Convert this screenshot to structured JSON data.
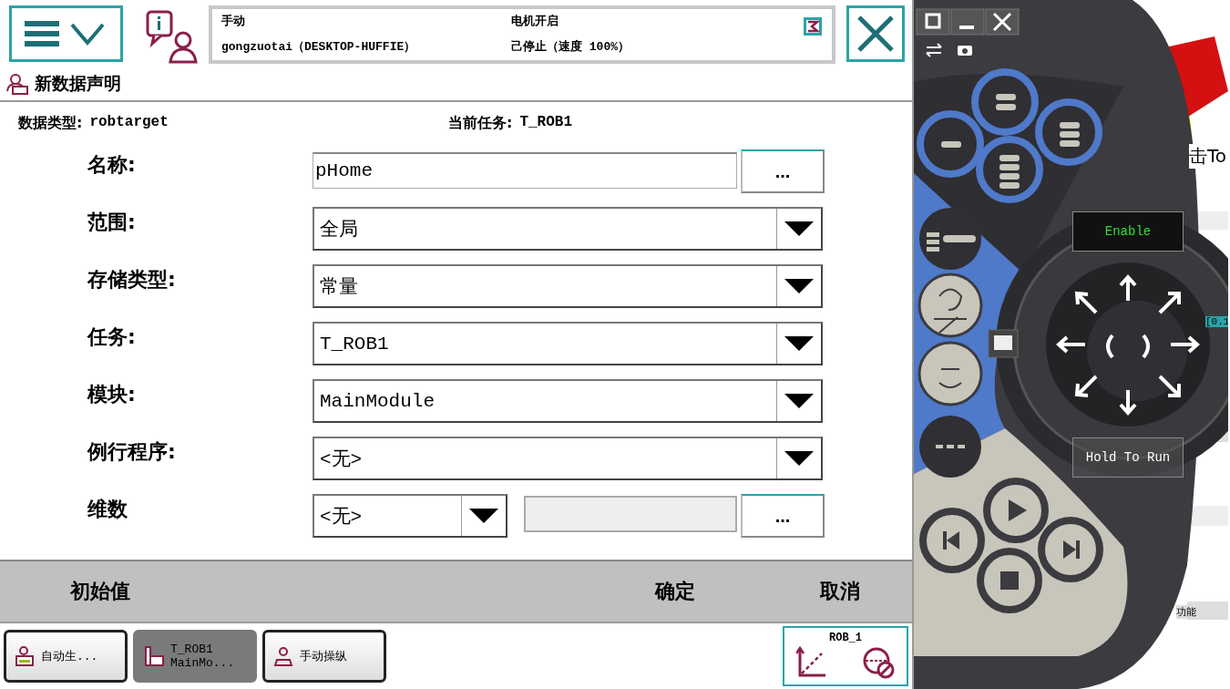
{
  "status": {
    "mode": "手动",
    "system": "gongzuotai（DESKTOP-HUFFIE）",
    "motors": "电机开启",
    "state": "己停止（速度 100%）"
  },
  "title": "新数据声明",
  "info": [
    {
      "label": "数据类型:",
      "value": "robtarget"
    },
    {
      "label": "当前任务:",
      "value": "T_ROB1"
    }
  ],
  "fields": [
    {
      "kind": "text",
      "label": "名称:",
      "value": "pHome",
      "button": "..."
    },
    {
      "kind": "dropdown",
      "label": "范围:",
      "value": "全局"
    },
    {
      "kind": "dropdown",
      "label": "存储类型:",
      "value": "常量"
    },
    {
      "kind": "dropdown",
      "label": "任务:",
      "value": "T_ROB1"
    },
    {
      "kind": "dropdown",
      "label": "模块:",
      "value": "MainModule"
    },
    {
      "kind": "dropdown",
      "label": "例行程序:",
      "value": "<无>"
    },
    {
      "kind": "dims",
      "label": "维数",
      "value": "<无>",
      "button": "..."
    }
  ],
  "commands": [
    "初始值",
    "确定",
    "取消"
  ],
  "taskbar": [
    {
      "label": "自动生...",
      "selected": false
    },
    {
      "label": "T_ROB1\nMainMo...",
      "selected": true
    },
    {
      "label": "手动操纵",
      "selected": false
    }
  ],
  "quickset": {
    "label": "ROB_1"
  },
  "pendant": {
    "enable": "Enable",
    "hold_to_run": "Hold To Run"
  },
  "background_window": [
    "击To",
    "[0.1",
    "功能"
  ]
}
